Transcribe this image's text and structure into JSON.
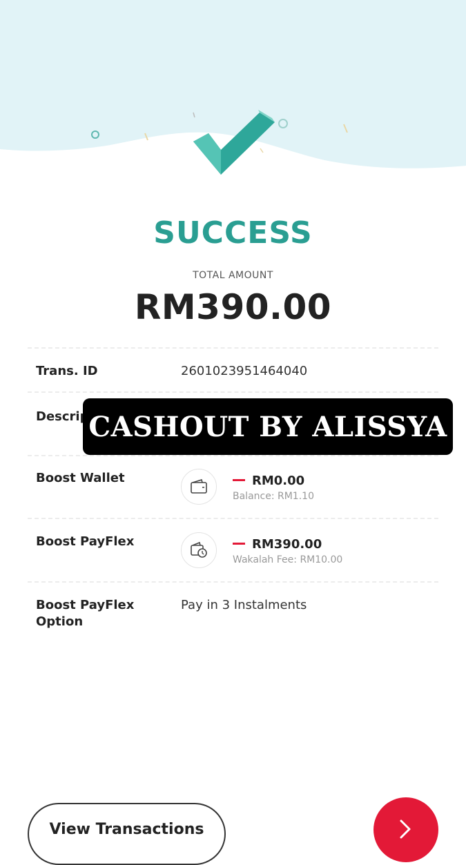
{
  "status": {
    "title": "SUCCESS"
  },
  "total": {
    "label": "TOTAL AMOUNT",
    "amount": "RM390.00"
  },
  "details": {
    "trans_id": {
      "label": "Trans. ID",
      "value": "2601023951464040"
    },
    "description": {
      "label": "Descrip"
    },
    "boost_wallet": {
      "label": "Boost Wallet",
      "amount": "RM0.00",
      "sub": "Balance: RM1.10",
      "icon": "wallet-icon"
    },
    "boost_payflex": {
      "label": "Boost PayFlex",
      "amount": "RM390.00",
      "sub": "Wakalah Fee: RM10.00",
      "icon": "wallet-clock-icon"
    },
    "payflex_option": {
      "label_line1": "Boost PayFlex",
      "label_line2": "Option",
      "value": "Pay in 3 Instalments"
    }
  },
  "overlay_text": "CASHOUT BY ALISSYA",
  "buttons": {
    "view_transactions": "View Transactions",
    "next_icon": "chevron-right-icon"
  },
  "colors": {
    "accent_teal": "#2a9e92",
    "hero_bg": "#e1f3f7",
    "brand_red": "#e31937"
  }
}
